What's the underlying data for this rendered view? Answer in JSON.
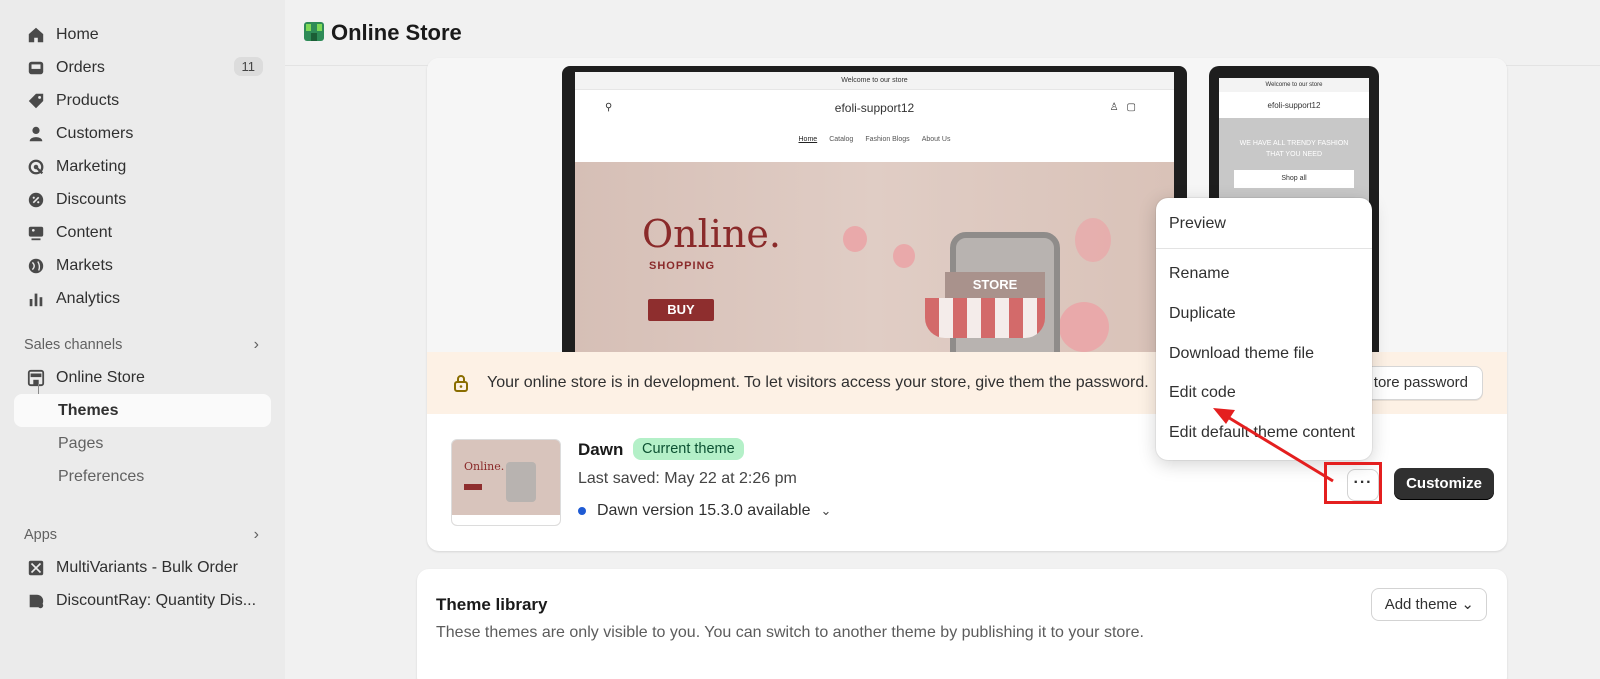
{
  "sidebar": {
    "items": [
      {
        "label": "Home",
        "icon": "home-icon"
      },
      {
        "label": "Orders",
        "icon": "orders-icon",
        "badge": "11"
      },
      {
        "label": "Products",
        "icon": "tag-icon"
      },
      {
        "label": "Customers",
        "icon": "person-icon"
      },
      {
        "label": "Marketing",
        "icon": "target-icon"
      },
      {
        "label": "Discounts",
        "icon": "discount-icon"
      },
      {
        "label": "Content",
        "icon": "content-icon"
      },
      {
        "label": "Markets",
        "icon": "globe-icon"
      },
      {
        "label": "Analytics",
        "icon": "bar-chart-icon"
      }
    ],
    "sales_channels_label": "Sales channels",
    "online_store": "Online Store",
    "sub": [
      "Themes",
      "Pages",
      "Preferences"
    ],
    "apps_label": "Apps",
    "apps": [
      "MultiVariants - Bulk Order",
      "DiscountRay: Quantity Dis..."
    ]
  },
  "header": {
    "title": "Online Store"
  },
  "preview": {
    "announcement": "Welcome to our store",
    "store_name": "efoli-support12",
    "links": [
      "Home",
      "Catalog",
      "Fashion Blogs",
      "About Us"
    ],
    "hero_title": "Online.",
    "hero_sub": "SHOPPING",
    "hero_buy": "BUY",
    "store_sign": "STORE",
    "mobile_announcement": "Welcome to our store",
    "mobile_text": "WE HAVE ALL TRENDY FASHION THAT YOU NEED",
    "mobile_button": "Shop all"
  },
  "banner": {
    "text": "Your online store is in development. To let visitors access your store, give them the password.",
    "button": "tore password"
  },
  "theme": {
    "name": "Dawn",
    "badge": "Current theme",
    "saved": "Last saved: May 22 at 2:26 pm",
    "version": "Dawn version 15.3.0 available",
    "more": "···",
    "customize": "Customize",
    "thumb_title": "Online."
  },
  "menu": {
    "items": [
      "Preview",
      "Rename",
      "Duplicate",
      "Download theme file",
      "Edit code",
      "Edit default theme content"
    ]
  },
  "library": {
    "title": "Theme library",
    "desc": "These themes are only visible to you. You can switch to another theme by publishing it to your store.",
    "add_button": "Add theme"
  },
  "colors": {
    "accent_red": "#e41f1f",
    "badge_green": "#b4f0c8",
    "banner_bg": "#fdf1e5"
  }
}
